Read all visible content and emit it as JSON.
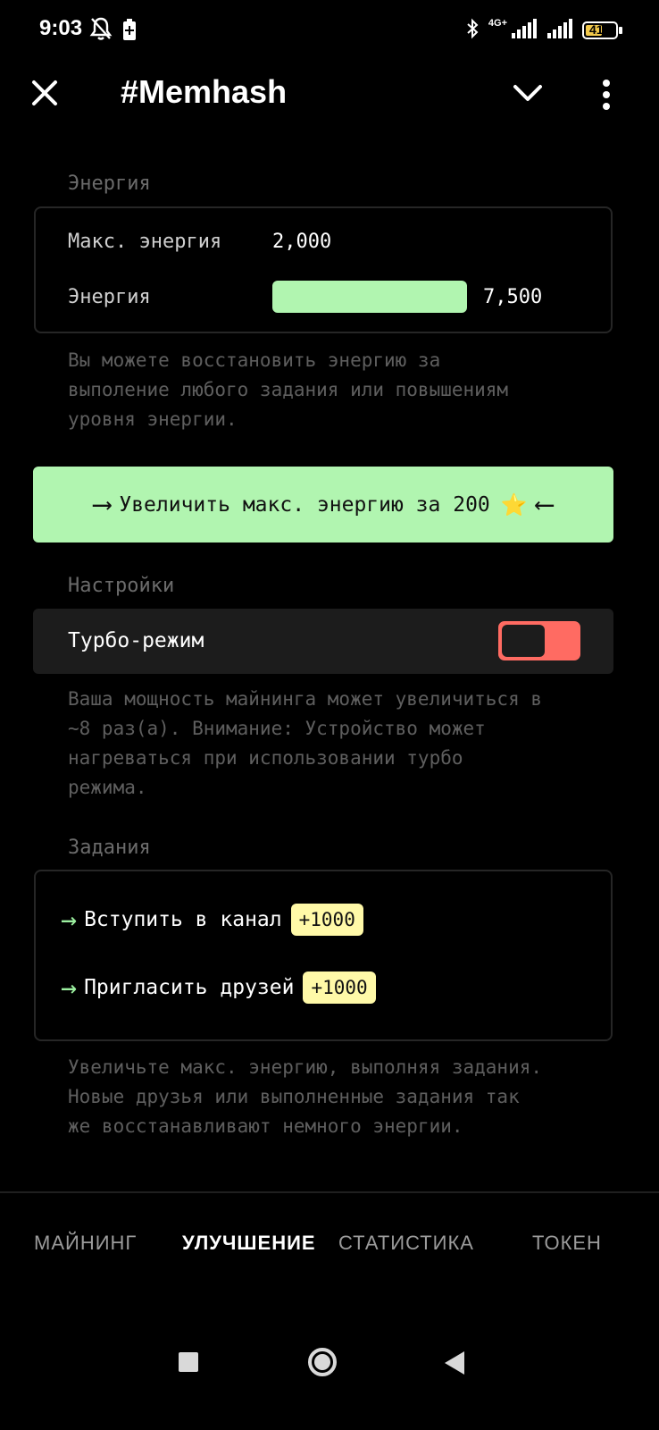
{
  "status_bar": {
    "time": "9:03",
    "network": "4G+",
    "battery": "41"
  },
  "header": {
    "title": "#Memhash",
    "icons": [
      "close-icon",
      "chevron-down-icon",
      "more-vertical-icon"
    ]
  },
  "energy": {
    "section_label": "Энергия",
    "max_label": "Макс. энергия",
    "max_value": "2,000",
    "current_label": "Энергия",
    "current_value": "7,500",
    "bar_fill": 1.0,
    "bar_color": "#b1f5b0",
    "note": "Вы можете восстановить энергию за\nвыполение любого задания или повышениям\nуровня энергии."
  },
  "cta": {
    "label": "Увеличить макс. энергию за 200",
    "left_arrow": "⟶",
    "right_arrow": "⟵",
    "star": "⭐",
    "color": "#b1f5b0"
  },
  "settings": {
    "section_label": "Настройки",
    "turbo_label": "Турбо-режим",
    "turbo_enabled": false,
    "toggle_color": "#ff6b62",
    "note": "Ваша мощность майнинга может увеличиться в\n~8 раз(а). Внимание: Устройство может\nнагреваться при использовании турбо\nрежима."
  },
  "tasks": {
    "section_label": "Задания",
    "arrow_color": "#9cf0a0",
    "badge_color": "#fff9a8",
    "items": [
      {
        "arrow": "→",
        "label": "Вступить в канал",
        "reward": "+1000"
      },
      {
        "arrow": "→",
        "label": "Пригласить друзей",
        "reward": "+1000"
      }
    ],
    "note": "Увеличьте макс. энергию, выполняя задания.\nНовые друзья или выполненные задания так\nже восстанавливают немного энергии."
  },
  "bottom_nav": {
    "active": "УЛУЧШЕНИЕ",
    "tabs": [
      "МАЙНИНГ",
      "УЛУЧШЕНИЕ",
      "СТАТИСТИКА",
      "ТОКЕН"
    ]
  },
  "system_nav": {
    "icons": [
      "square-icon",
      "circle-icon",
      "triangle-back-icon"
    ]
  }
}
